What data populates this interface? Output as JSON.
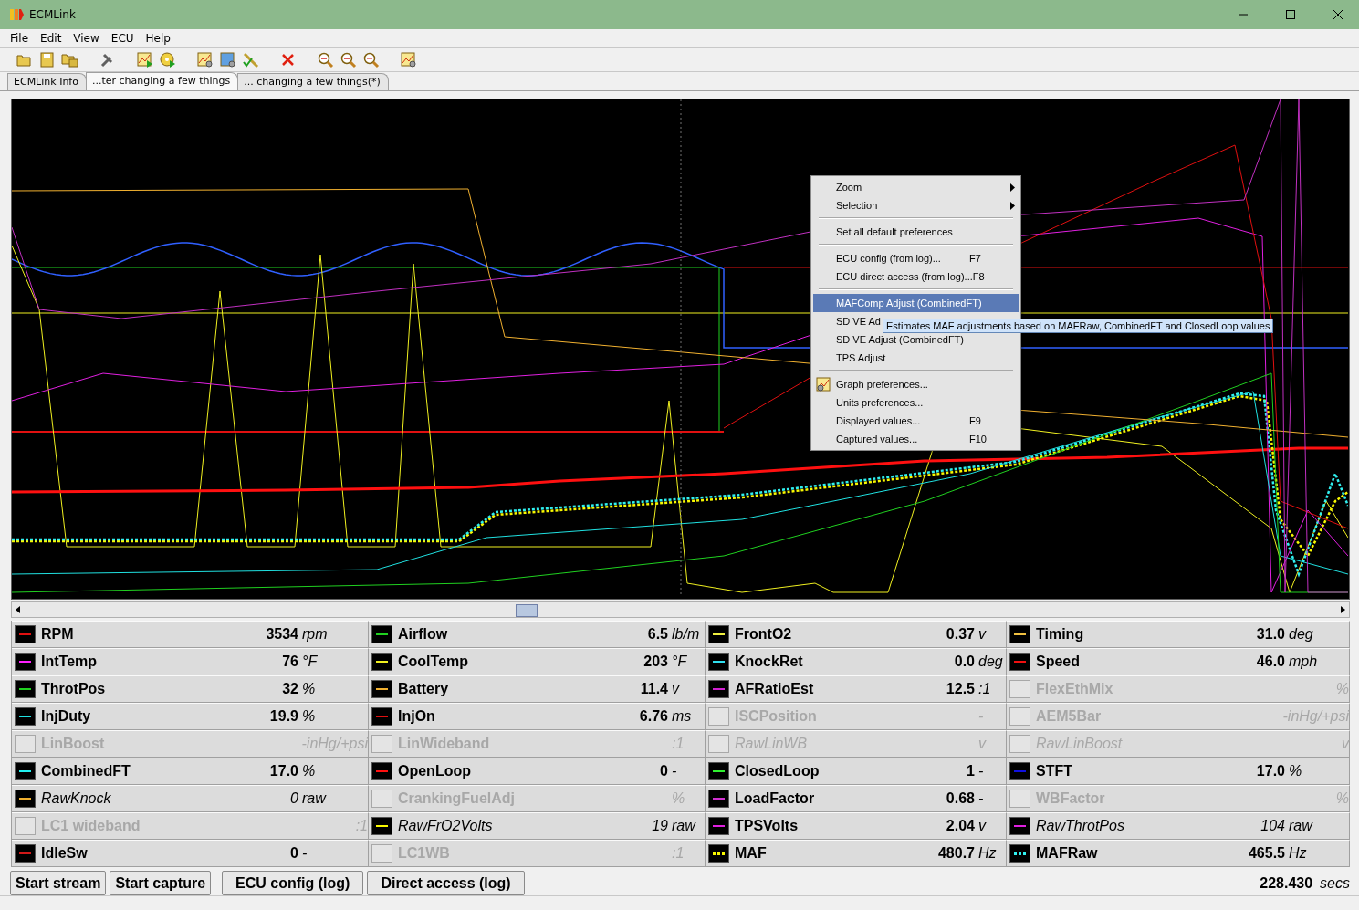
{
  "window": {
    "title": "ECMLink"
  },
  "menu": [
    "File",
    "Edit",
    "View",
    "ECU",
    "Help"
  ],
  "tabs": [
    {
      "label": "ECMLink Info",
      "selected": false
    },
    {
      "label": "...ter changing a few things",
      "selected": true
    },
    {
      "label": "... changing a few things(*)",
      "selected": false
    }
  ],
  "context_menu": [
    {
      "kind": "submenu",
      "label": "Zoom",
      "selected": false
    },
    {
      "kind": "submenu",
      "label": "Selection",
      "selected": false
    },
    {
      "kind": "separator"
    },
    {
      "kind": "item",
      "label": "Set all default preferences",
      "selected": false
    },
    {
      "kind": "separator"
    },
    {
      "kind": "item",
      "label": "ECU config (from log)...",
      "shortcut": "F7",
      "selected": false
    },
    {
      "kind": "item",
      "label": "ECU direct access (from log)...",
      "shortcut": "F8",
      "selected": false
    },
    {
      "kind": "separator"
    },
    {
      "kind": "item",
      "label": "MAFComp Adjust (CombinedFT)",
      "selected": true
    },
    {
      "kind": "item",
      "label": "SD VE Ad",
      "selected": false
    },
    {
      "kind": "item",
      "label": "SD VE Adjust (CombinedFT)",
      "selected": false
    },
    {
      "kind": "item",
      "label": "TPS Adjust",
      "selected": false
    },
    {
      "kind": "separator"
    },
    {
      "kind": "icon-item",
      "label": "Graph preferences...",
      "selected": false
    },
    {
      "kind": "item",
      "label": "Units preferences...",
      "selected": false
    },
    {
      "kind": "item",
      "label": "Displayed values...",
      "shortcut": "F9",
      "selected": false
    },
    {
      "kind": "item",
      "label": "Captured values...",
      "shortcut": "F10",
      "selected": false
    }
  ],
  "tooltip": "Estimates MAF adjustments based on MAFRaw, CombinedFT and ClosedLoop values",
  "columns": [
    {
      "items": [
        {
          "name": "RPM",
          "value": "3534",
          "unit": "rpm",
          "enabled": true,
          "kind": "calc",
          "dotted": false,
          "color": "#e01010"
        },
        {
          "name": "IntTemp",
          "value": "76",
          "unit": "°F",
          "enabled": true,
          "kind": "calc",
          "dotted": false,
          "color": "#ff20ff"
        },
        {
          "name": "ThrotPos",
          "value": "32",
          "unit": "%",
          "enabled": true,
          "kind": "calc",
          "dotted": false,
          "color": "#20d020"
        },
        {
          "name": "InjDuty",
          "value": "19.9",
          "unit": "%",
          "enabled": true,
          "kind": "calc",
          "dotted": false,
          "color": "#20e0e0"
        },
        {
          "name": "LinBoost",
          "unit": "-inHg/+psi",
          "enabled": false,
          "kind": "calc"
        },
        {
          "name": "CombinedFT",
          "value": "17.0",
          "unit": "%",
          "enabled": true,
          "kind": "calc",
          "dotted": false,
          "color": "#20f0f0"
        },
        {
          "name": "RawKnock",
          "value": "0",
          "unit": "raw",
          "enabled": true,
          "kind": "raw",
          "dotted": false,
          "color": "#f0b030"
        },
        {
          "name": "LC1 wideband",
          "unit": ":1",
          "enabled": false,
          "kind": "calc"
        },
        {
          "name": "IdleSw",
          "value": "0",
          "unit": "-",
          "enabled": true,
          "kind": "calc",
          "dotted": false,
          "color": "#d01818"
        }
      ]
    },
    {
      "items": [
        {
          "name": "Airflow",
          "value": "6.5",
          "unit": "lb/m",
          "enabled": true,
          "kind": "calc",
          "dotted": false,
          "color": "#20d020"
        },
        {
          "name": "CoolTemp",
          "value": "203",
          "unit": "°F",
          "enabled": true,
          "kind": "calc",
          "dotted": false,
          "color": "#f0f020"
        },
        {
          "name": "Battery",
          "value": "11.4",
          "unit": "v",
          "enabled": true,
          "kind": "calc",
          "dotted": false,
          "color": "#f0b030"
        },
        {
          "name": "InjOn",
          "value": "6.76",
          "unit": "ms",
          "enabled": true,
          "kind": "calc",
          "dotted": false,
          "color": "#e01010"
        },
        {
          "name": "LinWideband",
          "unit": ":1",
          "enabled": false,
          "kind": "calc"
        },
        {
          "name": "OpenLoop",
          "value": "0",
          "unit": "-",
          "enabled": true,
          "kind": "calc",
          "dotted": false,
          "color": "#ff1010"
        },
        {
          "name": "CrankingFuelAdj",
          "unit": "%",
          "enabled": false,
          "kind": "calc"
        },
        {
          "name": "RawFrO2Volts",
          "value": "19",
          "unit": "raw",
          "enabled": true,
          "kind": "raw",
          "dotted": false,
          "color": "#f8f800"
        },
        {
          "name": "LC1WB",
          "unit": ":1",
          "enabled": false,
          "kind": "calc"
        }
      ]
    },
    {
      "items": [
        {
          "name": "FrontO2",
          "value": "0.37",
          "unit": "v",
          "enabled": true,
          "kind": "calc",
          "dotted": false,
          "color": "#f0f040"
        },
        {
          "name": "KnockRet",
          "value": "0.0",
          "unit": "deg",
          "enabled": true,
          "kind": "calc",
          "dotted": false,
          "color": "#30e0f0"
        },
        {
          "name": "AFRatioEst",
          "value": "12.5",
          "unit": ":1",
          "enabled": true,
          "kind": "calc",
          "dotted": false,
          "color": "#d020d0"
        },
        {
          "name": "ISCPosition",
          "unit": "-",
          "enabled": false,
          "kind": "calc"
        },
        {
          "name": "RawLinWB",
          "unit": "v",
          "enabled": false,
          "kind": "raw"
        },
        {
          "name": "ClosedLoop",
          "value": "1",
          "unit": "-",
          "enabled": true,
          "kind": "calc",
          "dotted": false,
          "color": "#30f030"
        },
        {
          "name": "LoadFactor",
          "value": "0.68",
          "unit": "-",
          "enabled": true,
          "kind": "calc",
          "dotted": false,
          "color": "#d030d0"
        },
        {
          "name": "TPSVolts",
          "value": "2.04",
          "unit": "v",
          "enabled": true,
          "kind": "calc",
          "dotted": false,
          "color": "#e020e0"
        },
        {
          "name": "MAF",
          "value": "480.7",
          "unit": "Hz",
          "enabled": true,
          "kind": "calc",
          "dotted": true,
          "color": "#f8f800"
        }
      ]
    },
    {
      "items": [
        {
          "name": "Timing",
          "value": "31.0",
          "unit": "deg",
          "enabled": true,
          "kind": "calc",
          "dotted": false,
          "color": "#f0c040"
        },
        {
          "name": "Speed",
          "value": "46.0",
          "unit": "mph",
          "enabled": true,
          "kind": "calc",
          "dotted": false,
          "color": "#f01010"
        },
        {
          "name": "FlexEthMix",
          "unit": "%",
          "enabled": false,
          "kind": "calc"
        },
        {
          "name": "AEM5Bar",
          "unit": "-inHg/+psi",
          "enabled": false,
          "kind": "calc"
        },
        {
          "name": "RawLinBoost",
          "unit": "v",
          "enabled": false,
          "kind": "raw"
        },
        {
          "name": "STFT",
          "value": "17.0",
          "unit": "%",
          "enabled": true,
          "kind": "calc",
          "dotted": false,
          "color": "#1010e0"
        },
        {
          "name": "WBFactor",
          "unit": "%",
          "enabled": false,
          "kind": "calc"
        },
        {
          "name": "RawThrotPos",
          "value": "104",
          "unit": "raw",
          "enabled": true,
          "kind": "raw",
          "dotted": false,
          "color": "#e020e0"
        },
        {
          "name": "MAFRaw",
          "value": "465.5",
          "unit": "Hz",
          "enabled": true,
          "kind": "calc",
          "dotted": true,
          "color": "#30f0f0"
        }
      ]
    }
  ],
  "buttons": [
    "Start stream",
    "Start capture",
    "ECU config (log)",
    "Direct access (log)"
  ],
  "elapsed": {
    "value": "228.430",
    "unit": "secs"
  }
}
